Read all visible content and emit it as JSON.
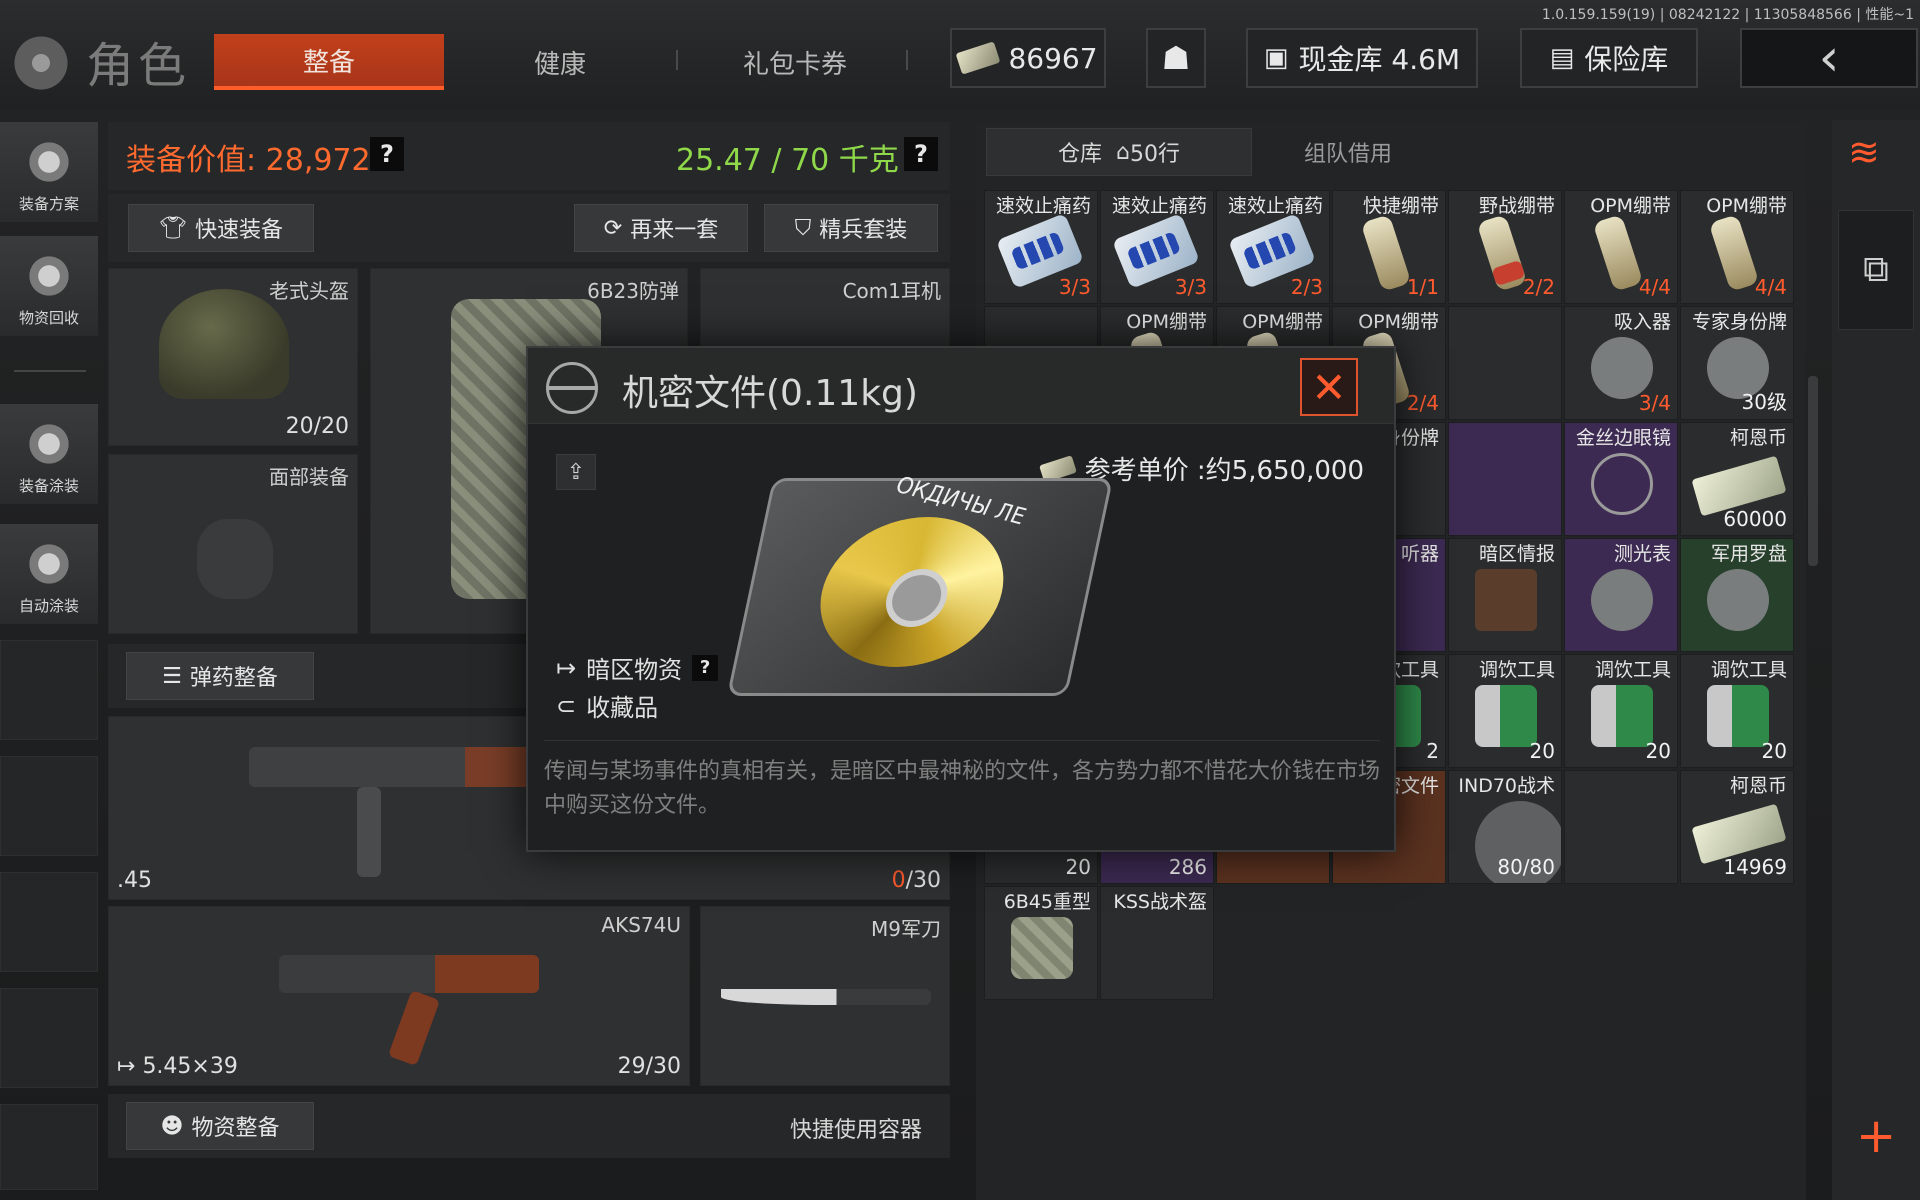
{
  "version": "1.0.159.159(19) | 08242122 | 11305848566 | 性能~1",
  "header": {
    "title": "角色",
    "tabs": [
      "整备",
      "健康",
      "礼包卡券"
    ],
    "active_tab": "整备",
    "currency": "86967",
    "cash_vault": "现金库 4.6M",
    "safe_vault": "保险库"
  },
  "sidebar": {
    "items": [
      "装备方案",
      "物资回收",
      "装备涂装",
      "自动涂装"
    ]
  },
  "loadout": {
    "value_label": "装备价值: 28,972",
    "weight": "25.47 / 70 千克",
    "help": "?",
    "quick_equip": "快速装备",
    "again": "再来一套",
    "elite": "精兵套装",
    "helmet": {
      "name": "老式头盔",
      "count": "20/20"
    },
    "armor": {
      "name": "6B23防弹"
    },
    "headset": {
      "name": "Com1耳机"
    },
    "face": {
      "name": "面部装备"
    },
    "ammo_btn": "弹药整备",
    "primary": {
      "ammo": ".45",
      "mag_cur": "0",
      "mag_max": "/30"
    },
    "secondary": {
      "name": "AKS74U",
      "ammo": "5.45×39",
      "count": "29/30"
    },
    "melee": {
      "name": "M9军刀"
    },
    "supply_btn": "物资整备",
    "quick_container": "快捷使用容器"
  },
  "warehouse": {
    "tab_storage": "仓库",
    "rows": "50行",
    "tab_team": "组队借用",
    "items": [
      {
        "name": "速效止痛药",
        "count": "3/3",
        "color": "red",
        "kind": "pill",
        "bg": ""
      },
      {
        "name": "速效止痛药",
        "count": "3/3",
        "color": "red",
        "kind": "pill",
        "bg": ""
      },
      {
        "name": "速效止痛药",
        "count": "2/3",
        "color": "red",
        "kind": "pill",
        "bg": ""
      },
      {
        "name": "快捷绷带",
        "count": "1/1",
        "color": "red",
        "kind": "band",
        "bg": ""
      },
      {
        "name": "野战绷带",
        "count": "2/2",
        "color": "red",
        "kind": "bandred",
        "bg": ""
      },
      {
        "name": "OPM绷带",
        "count": "4/4",
        "color": "red",
        "kind": "band",
        "bg": ""
      },
      {
        "name": "OPM绷带",
        "count": "4/4",
        "color": "red",
        "kind": "band",
        "bg": ""
      },
      {
        "name": "",
        "count": "",
        "color": "",
        "kind": "",
        "bg": ""
      },
      {
        "name": "OPM绷带",
        "count": "",
        "color": "",
        "kind": "band",
        "bg": ""
      },
      {
        "name": "OPM绷带",
        "count": "",
        "color": "",
        "kind": "band",
        "bg": ""
      },
      {
        "name": "OPM绷带",
        "count": "2/4",
        "color": "red",
        "kind": "band",
        "bg": ""
      },
      {
        "name": "",
        "count": "",
        "color": "",
        "kind": "",
        "bg": ""
      },
      {
        "name": "吸入器",
        "count": "3/4",
        "color": "red",
        "kind": "round",
        "bg": ""
      },
      {
        "name": "专家身份牌",
        "count": "30级",
        "color": "",
        "kind": "tag",
        "bg": ""
      },
      {
        "name": "",
        "count": "",
        "color": "",
        "kind": "",
        "bg": ""
      },
      {
        "name": "",
        "count": "",
        "color": "",
        "kind": "",
        "bg": ""
      },
      {
        "name": "",
        "count": "",
        "color": "",
        "kind": "",
        "bg": ""
      },
      {
        "name": "牌身份牌",
        "count": "",
        "color": "",
        "kind": "",
        "bg": ""
      },
      {
        "name": "",
        "count": "",
        "color": "",
        "kind": "",
        "bg": "purple"
      },
      {
        "name": "金丝边眼镜",
        "count": "",
        "color": "",
        "kind": "glasses",
        "bg": "purple"
      },
      {
        "name": "柯恩币",
        "count": "60000",
        "color": "",
        "kind": "cash",
        "bg": ""
      },
      {
        "name": "",
        "count": "",
        "color": "",
        "kind": "",
        "bg": ""
      },
      {
        "name": "",
        "count": "",
        "color": "",
        "kind": "",
        "bg": ""
      },
      {
        "name": "",
        "count": "",
        "color": "",
        "kind": "",
        "bg": ""
      },
      {
        "name": "听器",
        "count": "",
        "color": "",
        "kind": "",
        "bg": "purple"
      },
      {
        "name": "暗区情报",
        "count": "",
        "color": "",
        "kind": "book",
        "bg": ""
      },
      {
        "name": "测光表",
        "count": "",
        "color": "",
        "kind": "round",
        "bg": "purple"
      },
      {
        "name": "军用罗盘",
        "count": "",
        "color": "",
        "kind": "round",
        "bg": "green"
      },
      {
        "name": "",
        "count": "",
        "color": "",
        "kind": "",
        "bg": ""
      },
      {
        "name": "",
        "count": "",
        "color": "",
        "kind": "",
        "bg": ""
      },
      {
        "name": "",
        "count": "",
        "color": "",
        "kind": "",
        "bg": ""
      },
      {
        "name": "饮工具",
        "count": "2",
        "color": "",
        "kind": "tools",
        "bg": ""
      },
      {
        "name": "调饮工具",
        "count": "20",
        "color": "",
        "kind": "tools",
        "bg": ""
      },
      {
        "name": "调饮工具",
        "count": "20",
        "color": "",
        "kind": "tools",
        "bg": ""
      },
      {
        "name": "调饮工具",
        "count": "20",
        "color": "",
        "kind": "tools",
        "bg": ""
      },
      {
        "name": "",
        "count": "20",
        "color": "",
        "kind": "",
        "bg": ""
      },
      {
        "name": "",
        "count": "286",
        "color": "",
        "kind": "",
        "bg": "purple"
      },
      {
        "name": "",
        "count": "",
        "color": "",
        "kind": "",
        "bg": "orange"
      },
      {
        "name": "密文件",
        "count": "",
        "color": "",
        "kind": "",
        "bg": "orange"
      },
      {
        "name": "IND70战术",
        "count": "80/80",
        "color": "",
        "kind": "helmet",
        "bg": ""
      },
      {
        "name": "",
        "count": "",
        "color": "",
        "kind": "",
        "bg": ""
      },
      {
        "name": "柯恩币",
        "count": "14969",
        "color": "",
        "kind": "cash",
        "bg": ""
      },
      {
        "name": "6B45重型",
        "count": "",
        "color": "",
        "kind": "vest",
        "bg": ""
      },
      {
        "name": "KSS战术盔",
        "count": "",
        "color": "",
        "kind": "",
        "bg": ""
      }
    ]
  },
  "modal": {
    "title": "机密文件(0.11kg)",
    "price": "参考单价 :约5,650,000",
    "tag1": "暗区物资",
    "tag2": "收藏品",
    "help": "?",
    "disk_label": "ОКДИЧЫ ЛЕ",
    "description": "传闻与某场事件的真相有关，是暗区中最神秘的文件，各方势力都不惜花大价钱在市场中购买这份文件。"
  }
}
